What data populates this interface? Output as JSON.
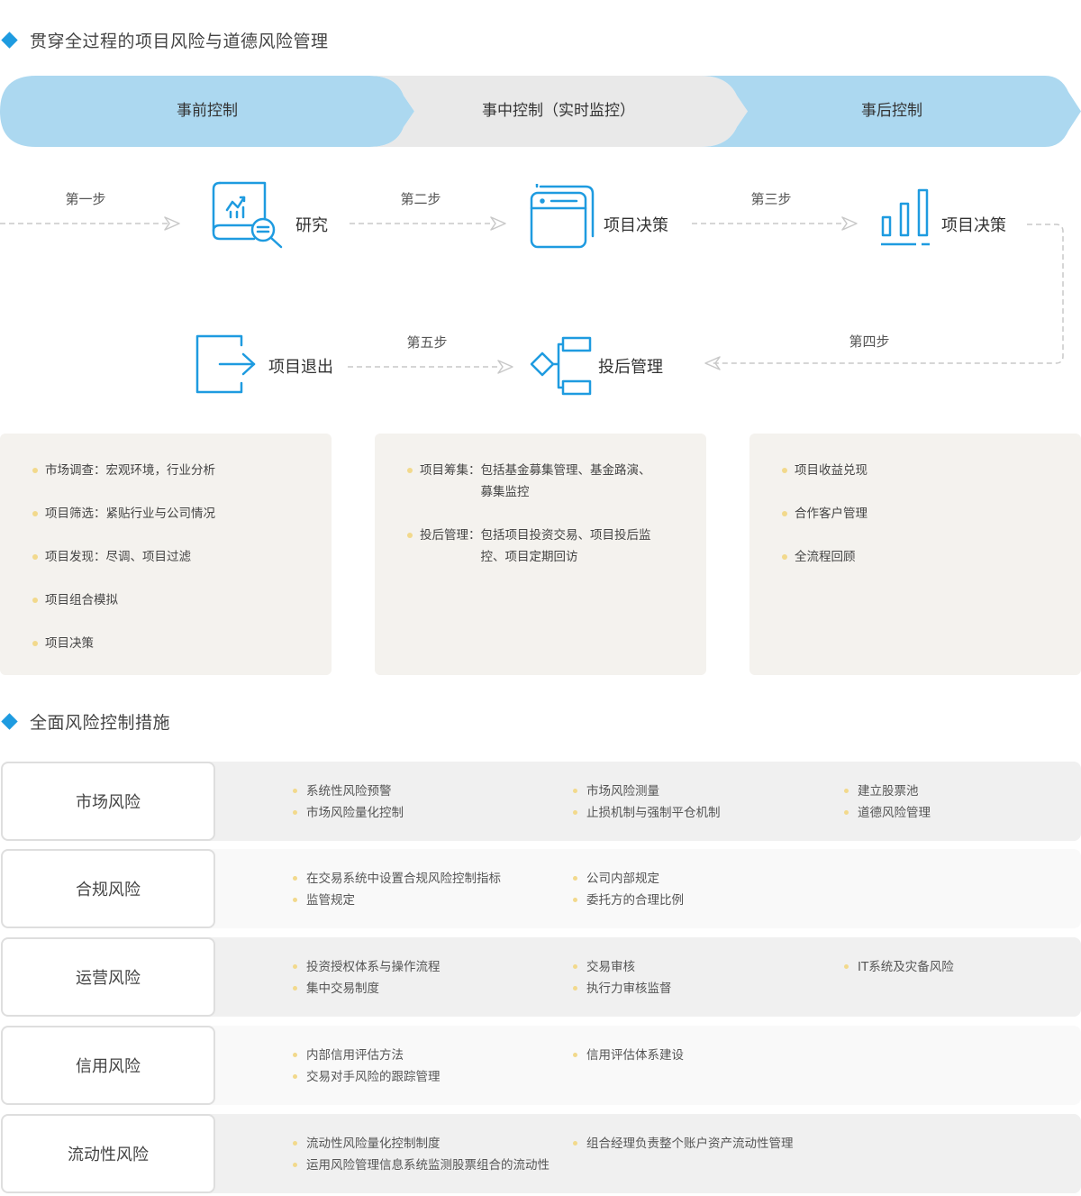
{
  "section1": {
    "title": "贯穿全过程的项目风险与道德风险管理"
  },
  "phases": [
    "事前控制",
    "事中控制（实时监控）",
    "事后控制"
  ],
  "steps": [
    "第一步",
    "第二步",
    "第三步",
    "第四步",
    "第五步"
  ],
  "nodes": {
    "research": "研究",
    "decision1": "项目决策",
    "decision2": "项目决策",
    "post_investment": "投后管理",
    "exit": "项目退出"
  },
  "cards": [
    {
      "items": [
        {
          "text": "市场调查：宏观环境，行业分析"
        },
        {
          "text": "项目筛选：紧贴行业与公司情况"
        },
        {
          "text": "项目发现：尽调、项目过滤"
        },
        {
          "text": "项目组合模拟"
        },
        {
          "text": "项目决策"
        }
      ]
    },
    {
      "items": [
        {
          "key": "项目筹集：",
          "value": "包括基金募集管理、基金路演、募集监控"
        },
        {
          "key": "投后管理：",
          "value": "包括项目投资交易、项目投后监控、项目定期回访"
        }
      ]
    },
    {
      "items": [
        {
          "text": "项目收益兑现"
        },
        {
          "text": "合作客户管理"
        },
        {
          "text": "全流程回顾"
        }
      ]
    }
  ],
  "section2": {
    "title": "全面风险控制措施"
  },
  "risks": [
    {
      "name": "市场风险",
      "columns": [
        [
          "系统性风险预警",
          "市场风险量化控制"
        ],
        [
          "市场风险测量",
          "止损机制与强制平仓机制"
        ],
        [
          "建立股票池",
          "道德风险管理"
        ]
      ]
    },
    {
      "name": "合规风险",
      "columns": [
        [
          "在交易系统中设置合规风险控制指标",
          "监管规定"
        ],
        [
          "公司内部规定",
          "委托方的合理比例"
        ],
        []
      ]
    },
    {
      "name": "运营风险",
      "columns": [
        [
          "投资授权体系与操作流程",
          "集中交易制度"
        ],
        [
          "交易审核",
          "执行力审核监督"
        ],
        [
          "IT系统及灾备风险"
        ]
      ]
    },
    {
      "name": "信用风险",
      "columns": [
        [
          "内部信用评估方法",
          "交易对手风险的跟踪管理"
        ],
        [
          "信用评估体系建设"
        ],
        []
      ]
    },
    {
      "name": "流动性风险",
      "columns": [
        [
          "流动性风险量化控制制度",
          "运用风险管理信息系统监测股票组合的流动性"
        ],
        [
          "组合经理负责整个账户资产流动性管理"
        ],
        []
      ]
    }
  ],
  "colors": {
    "accent": "#1e9be0",
    "phase_blue": "#acd8f0",
    "phase_grey": "#e9e9e9",
    "card_bg": "#f4f2ee",
    "bullet": "#f2d98c"
  }
}
